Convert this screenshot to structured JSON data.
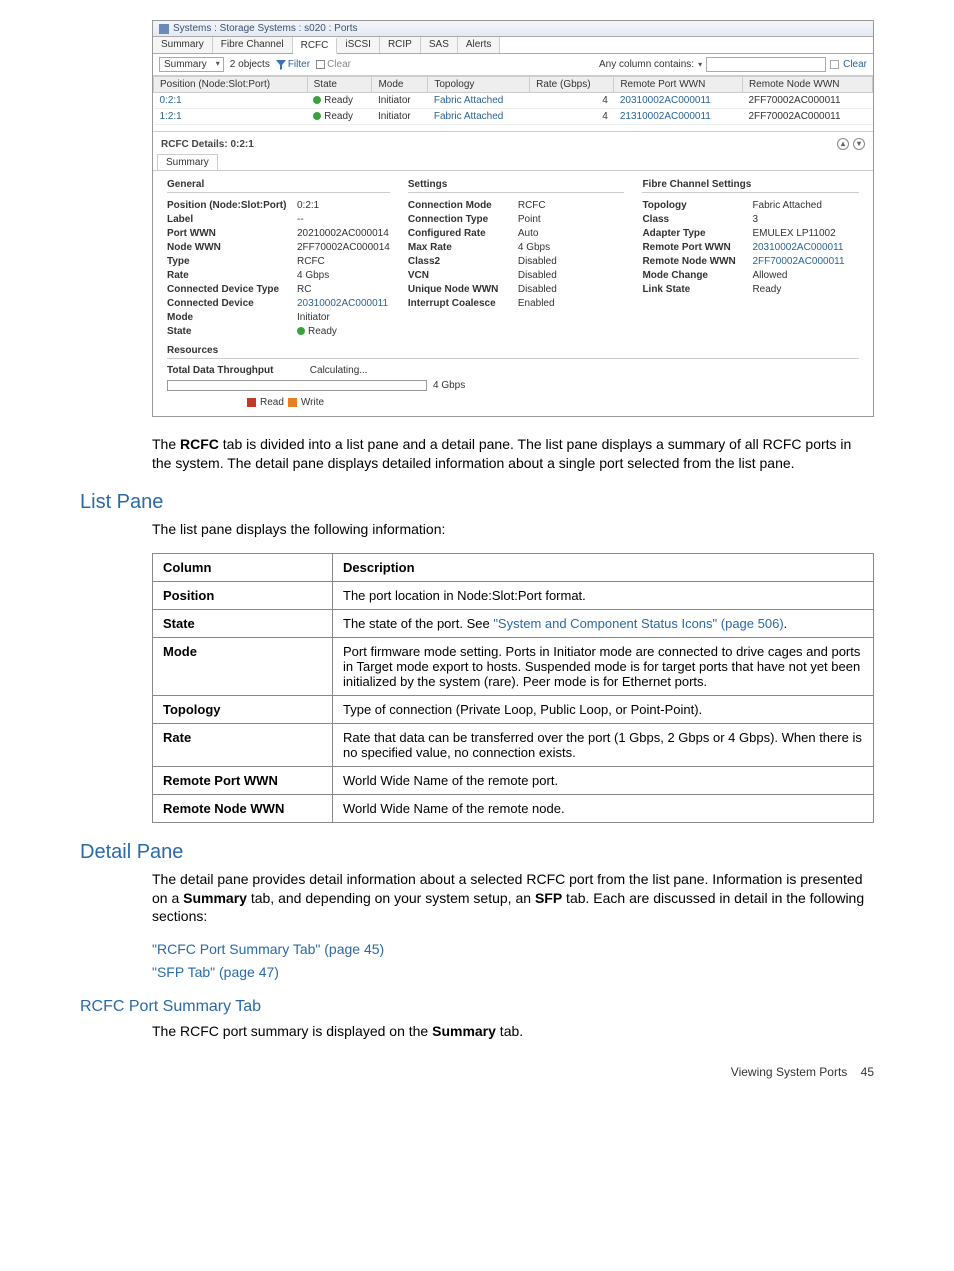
{
  "window": {
    "title": "Systems : Storage Systems : s020 : Ports",
    "tabs": [
      "Summary",
      "Fibre Channel",
      "RCFC",
      "iSCSI",
      "RCIP",
      "SAS",
      "Alerts"
    ],
    "active_tab": "RCFC"
  },
  "toolbar": {
    "view_dropdown": "Summary",
    "objects": "2 objects",
    "filter": "Filter",
    "clear": "Clear",
    "any_column": "Any column contains:",
    "clear_right": "Clear"
  },
  "list": {
    "headers": [
      "Position (Node:Slot:Port)",
      "State",
      "Mode",
      "Topology",
      "Rate (Gbps)",
      "Remote Port WWN",
      "Remote Node WWN"
    ],
    "rows": [
      {
        "pos": "0:2:1",
        "state": "Ready",
        "mode": "Initiator",
        "topology": "Fabric Attached",
        "rate": "4",
        "rpw": "20310002AC000011",
        "rnw": "2FF70002AC000011"
      },
      {
        "pos": "1:2:1",
        "state": "Ready",
        "mode": "Initiator",
        "topology": "Fabric Attached",
        "rate": "4",
        "rpw": "21310002AC000011",
        "rnw": "2FF70002AC000011"
      }
    ]
  },
  "detail": {
    "title": "RCFC Details: 0:2:1",
    "subtab": "Summary",
    "general_heading": "General",
    "settings_heading": "Settings",
    "fc_heading": "Fibre Channel Settings",
    "general": [
      {
        "k": "Position (Node:Slot:Port)",
        "v": "0:2:1"
      },
      {
        "k": "Label",
        "v": "--"
      },
      {
        "k": "Port WWN",
        "v": "20210002AC000014"
      },
      {
        "k": "Node WWN",
        "v": "2FF70002AC000014"
      },
      {
        "k": "Type",
        "v": "RCFC"
      },
      {
        "k": "Rate",
        "v": "4 Gbps"
      },
      {
        "k": "Connected Device Type",
        "v": "RC"
      },
      {
        "k": "Connected Device",
        "v": "20310002AC000011"
      },
      {
        "k": "Mode",
        "v": "Initiator"
      },
      {
        "k": "State",
        "v": "Ready",
        "dot": true
      }
    ],
    "settings": [
      {
        "k": "Connection Mode",
        "v": "RCFC"
      },
      {
        "k": "Connection Type",
        "v": "Point"
      },
      {
        "k": "Configured Rate",
        "v": "Auto"
      },
      {
        "k": "Max Rate",
        "v": "4 Gbps"
      },
      {
        "k": "Class2",
        "v": "Disabled"
      },
      {
        "k": "VCN",
        "v": "Disabled"
      },
      {
        "k": "Unique Node WWN",
        "v": "Disabled"
      },
      {
        "k": "Interrupt Coalesce",
        "v": "Enabled"
      }
    ],
    "fc": [
      {
        "k": "Topology",
        "v": "Fabric Attached"
      },
      {
        "k": "Class",
        "v": "3"
      },
      {
        "k": "Adapter Type",
        "v": "EMULEX LP11002"
      },
      {
        "k": "Remote Port WWN",
        "v": "20310002AC000011"
      },
      {
        "k": "Remote Node WWN",
        "v": "2FF70002AC000011"
      },
      {
        "k": "Mode Change",
        "v": "Allowed"
      },
      {
        "k": "Link State",
        "v": "Ready"
      }
    ],
    "resources_heading": "Resources",
    "thru_key": "Total Data Throughput",
    "thru_val": "Calculating...",
    "bar_right": "4 Gbps",
    "legend_read": "Read",
    "legend_write": "Write"
  },
  "doc": {
    "p1": "The RCFC tab is divided into a list pane and a detail pane. The list pane displays a summary of all RCFC ports in the system. The detail pane displays detailed information about a single port selected from the list pane.",
    "h_list": "List Pane",
    "list_intro": "The list pane displays the following information:",
    "table": {
      "headers": [
        "Column",
        "Description"
      ],
      "rows": [
        {
          "c": "Position",
          "d": "The port location in Node:Slot:Port format."
        },
        {
          "c": "State",
          "d_prefix": "The state of the port. See ",
          "d_link": "\"System and Component Status Icons\" (page 506)",
          "d_suffix": "."
        },
        {
          "c": "Mode",
          "d": "Port firmware mode setting. Ports in Initiator mode are connected to drive cages and ports in Target mode export to hosts. Suspended mode is for target ports that have not yet been initialized by the system (rare). Peer mode is for Ethernet ports."
        },
        {
          "c": "Topology",
          "d": "Type of connection (Private Loop, Public Loop, or Point-Point)."
        },
        {
          "c": "Rate",
          "d": "Rate that data can be transferred over the port (1 Gbps, 2 Gbps or 4 Gbps). When there is no specified value, no connection exists."
        },
        {
          "c": "Remote Port WWN",
          "d": "World Wide Name of the remote port."
        },
        {
          "c": "Remote Node WWN",
          "d": "World Wide Name of the remote node."
        }
      ]
    },
    "h_detail": "Detail Pane",
    "detail_p": "The detail pane provides detail information about a selected RCFC port from the list pane. Information is presented on a Summary tab, and depending on your system setup, an SFP tab. Each are discussed in detail in the following sections:",
    "link1": "\"RCFC Port Summary Tab\" (page 45)",
    "link2": "\"SFP Tab\" (page 47)",
    "h_rcfc": "RCFC Port Summary Tab",
    "rcfc_p": "The RCFC port summary is displayed on the Summary tab.",
    "footer_t": "Viewing System Ports",
    "footer_p": "45"
  }
}
